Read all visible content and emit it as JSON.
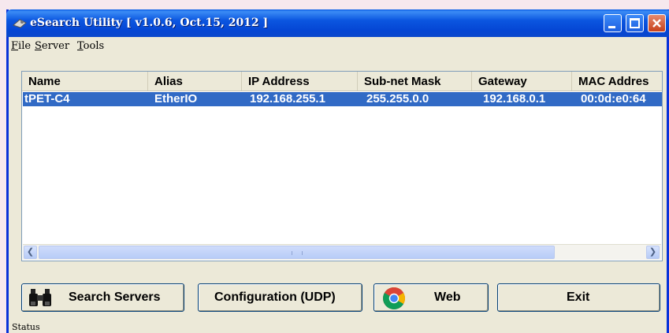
{
  "window": {
    "title": "eSearch Utility [ v1.0.6, Oct.15, 2012 ]"
  },
  "menu": {
    "items": [
      {
        "label": "File"
      },
      {
        "label": "Server"
      },
      {
        "label": "Tools"
      }
    ]
  },
  "table": {
    "columns": [
      "Name",
      "Alias",
      "IP Address",
      "Sub-net Mask",
      "Gateway",
      "MAC Addres"
    ],
    "rows": [
      {
        "name": "tPET-C4",
        "alias": "EtherIO",
        "ip": "192.168.255.1",
        "mask": "255.255.0.0",
        "gateway": "192.168.0.1",
        "mac": "00:0d:e0:64"
      }
    ],
    "selection_color": "#316ac5"
  },
  "buttons": {
    "search": "Search Servers",
    "config": "Configuration (UDP)",
    "web": "Web",
    "exit": "Exit"
  },
  "icons": {
    "title": "esearch-app-icon",
    "search": "binoculars-icon",
    "web": "chrome-browser-icon"
  },
  "status": {
    "text": "Status"
  }
}
